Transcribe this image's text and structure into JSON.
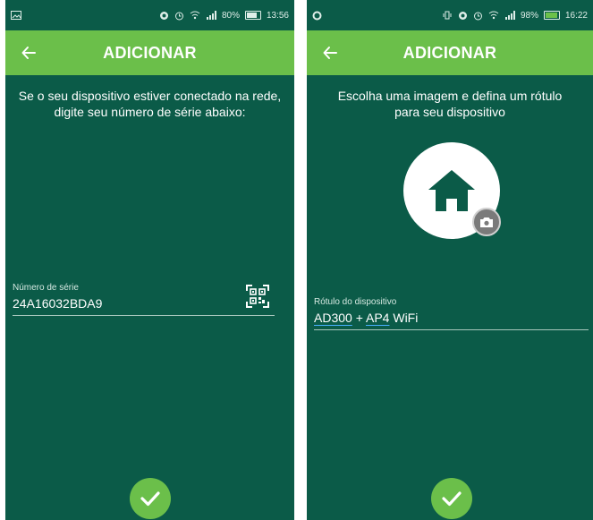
{
  "screen1": {
    "status": {
      "battery": "80%",
      "time": "13:56"
    },
    "appbar": {
      "title": "ADICIONAR"
    },
    "instruction": "Se o seu dispositivo estiver conectado na rede, digite seu número de série abaixo:",
    "serial": {
      "label": "Número de série",
      "value": "24A16032BDA9"
    }
  },
  "screen2": {
    "status": {
      "battery": "98%",
      "time": "16:22"
    },
    "appbar": {
      "title": "ADICIONAR"
    },
    "instruction": "Escolha uma imagem e defina um rótulo para seu dispositivo",
    "device_label": {
      "label": "Rótulo do dispositivo",
      "part1": "AD300",
      "sep": " + ",
      "part2": "AP4",
      "part3": " WiFi"
    }
  },
  "colors": {
    "background": "#0b5b48",
    "accent": "#6bbf4a"
  },
  "icons": [
    "back-arrow-icon",
    "qr-scan-icon",
    "home-icon",
    "camera-icon",
    "checkmark-icon",
    "wifi-icon",
    "signal-icon",
    "battery-icon",
    "alarm-icon",
    "image-icon"
  ]
}
